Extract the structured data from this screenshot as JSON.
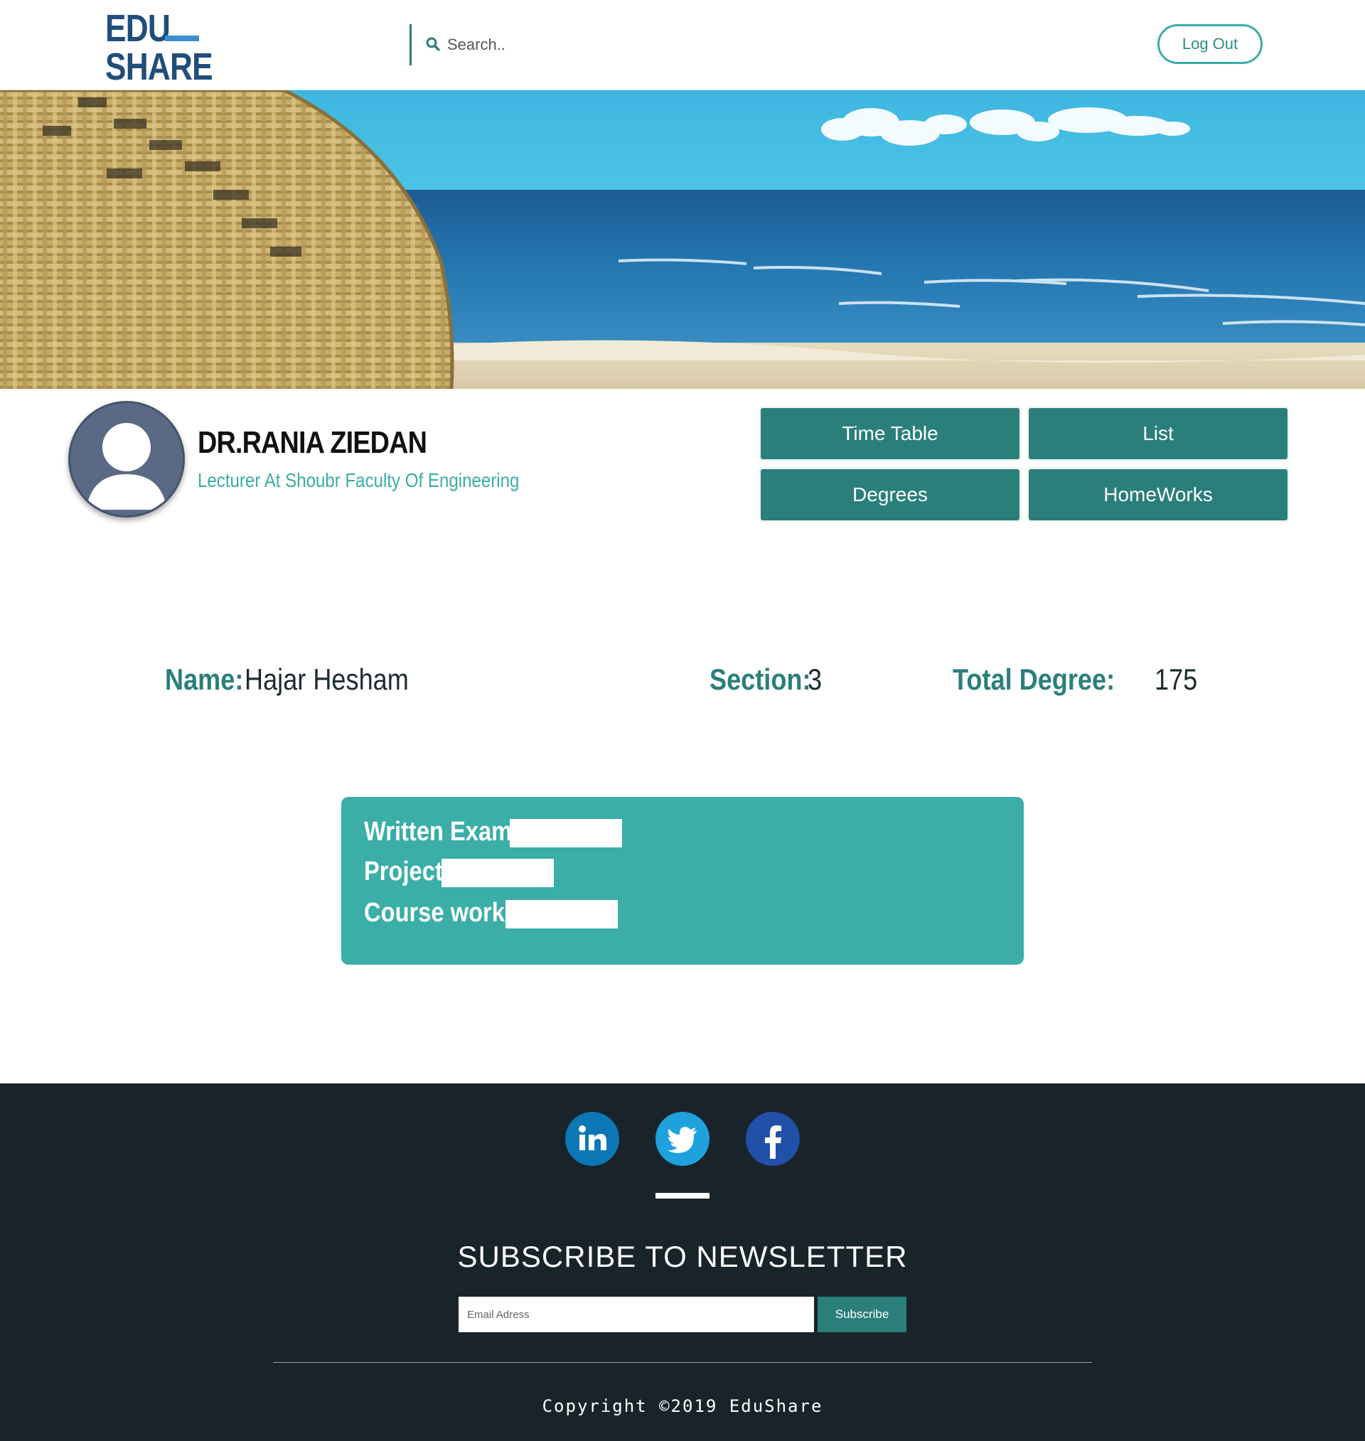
{
  "header": {
    "logo_line1": "EDU",
    "logo_line2": "SHARE",
    "search_placeholder": "Search..",
    "logout_label": "Log Out"
  },
  "profile": {
    "name": "DR.RANIA ZIEDAN",
    "role": "Lecturer At Shoubr Faculty Of Engineering",
    "nav_buttons": [
      "Time Table",
      "List",
      "Degrees",
      "HomeWorks"
    ]
  },
  "student": {
    "name_label": "Name:",
    "name_value": "Hajar Hesham",
    "section_label": "Section:",
    "section_value": "3",
    "total_label": "Total Degree:",
    "total_value": "175"
  },
  "degrees": {
    "written_exam_label": "Written Exam",
    "project_label": "Project",
    "course_work_label": "Course work"
  },
  "footer": {
    "social_icons": [
      "linkedin-icon",
      "twitter-icon",
      "facebook-icon"
    ],
    "newsletter_title": "SUBSCRIBE TO NEWSLETTER",
    "email_placeholder": "Email Adress",
    "subscribe_label": "Subscribe",
    "copyright": "Copyright ©2019 EduShare"
  },
  "colors": {
    "brand_teal": "#2a7f7a",
    "accent_teal": "#3aaea7",
    "logo_blue": "#1f4e79",
    "footer_bg": "#19232a"
  }
}
